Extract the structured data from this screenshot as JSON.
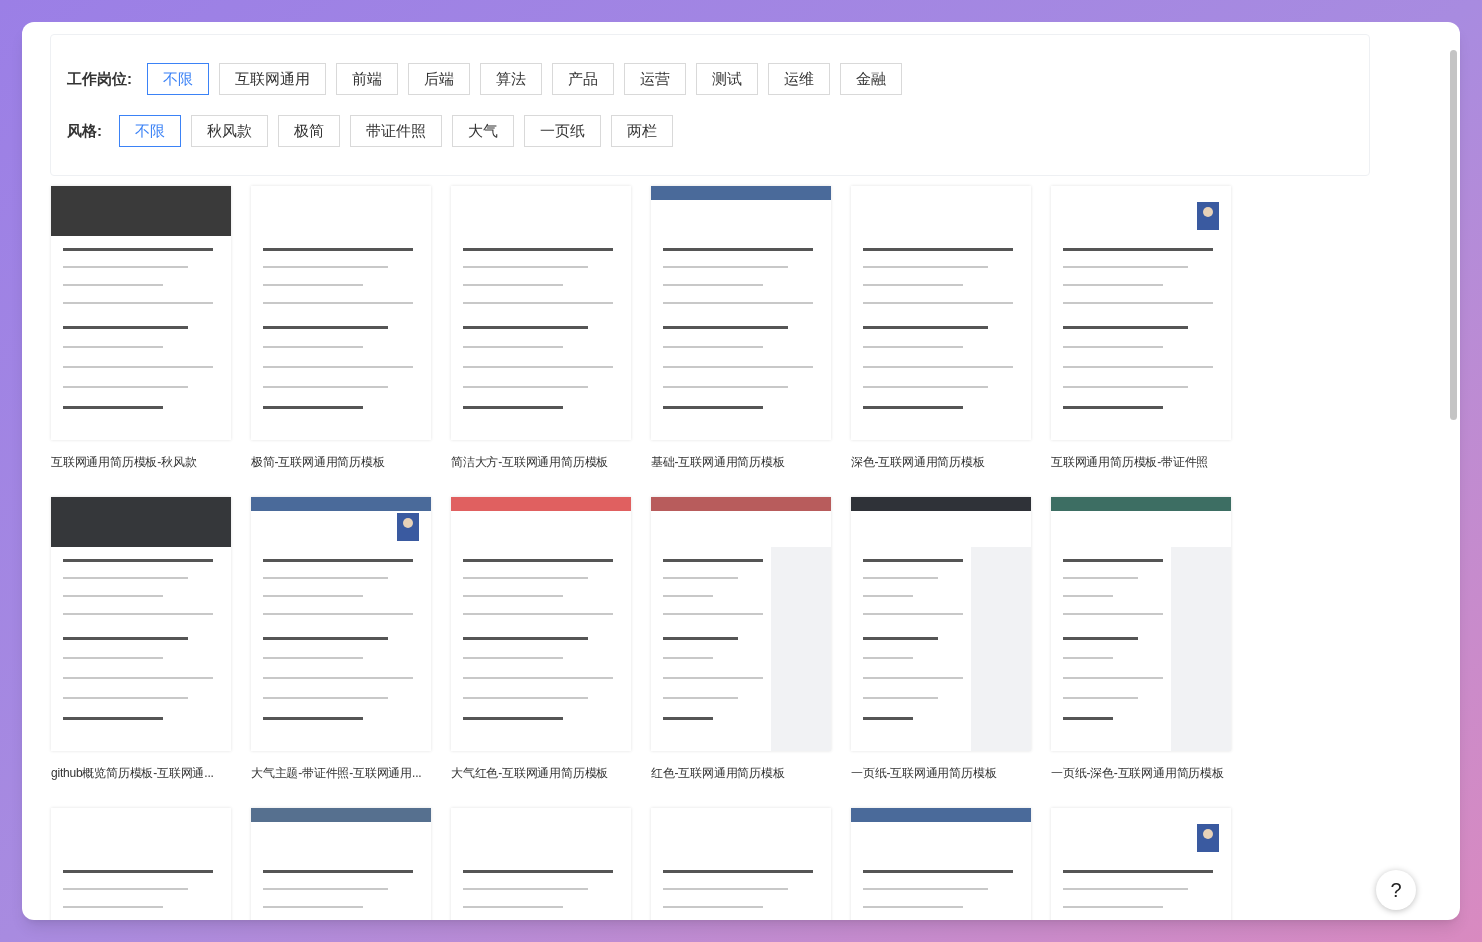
{
  "filters": [
    {
      "label": "工作岗位:",
      "options": [
        {
          "label": "不限",
          "selected": true
        },
        {
          "label": "互联网通用",
          "selected": false
        },
        {
          "label": "前端",
          "selected": false
        },
        {
          "label": "后端",
          "selected": false
        },
        {
          "label": "算法",
          "selected": false
        },
        {
          "label": "产品",
          "selected": false
        },
        {
          "label": "运营",
          "selected": false
        },
        {
          "label": "测试",
          "selected": false
        },
        {
          "label": "运维",
          "selected": false
        },
        {
          "label": "金融",
          "selected": false
        }
      ]
    },
    {
      "label": "风格:",
      "options": [
        {
          "label": "不限",
          "selected": true
        },
        {
          "label": "秋风款",
          "selected": false
        },
        {
          "label": "极简",
          "selected": false
        },
        {
          "label": "带证件照",
          "selected": false
        },
        {
          "label": "大气",
          "selected": false
        },
        {
          "label": "一页纸",
          "selected": false
        },
        {
          "label": "两栏",
          "selected": false
        }
      ]
    }
  ],
  "templates": [
    {
      "kind": "picture",
      "title": "互联网通用简历模板-秋风款"
    },
    {
      "kind": "picture",
      "title": "极简-互联网通用简历模板"
    },
    {
      "kind": "picture",
      "title": "简洁大方-互联网通用简历模板"
    },
    {
      "kind": "picture",
      "title": "基础-互联网通用简历模板"
    },
    {
      "kind": "picture",
      "title": "深色-互联网通用简历模板"
    },
    {
      "kind": "picture",
      "title": "互联网通用简历模板-带证件照"
    },
    {
      "kind": "picture",
      "title": "github概览简历模板-互联网通..."
    },
    {
      "kind": "picture",
      "title": "大气主题-带证件照-互联网通用..."
    },
    {
      "kind": "picture",
      "title": "大气红色-互联网通用简历模板"
    },
    {
      "kind": "picture",
      "title": "红色-互联网通用简历模板"
    },
    {
      "kind": "picture",
      "title": "一页纸-互联网通用简历模板"
    },
    {
      "kind": "picture",
      "title": "一页纸-深色-互联网通用简历模板"
    },
    {
      "kind": "picture"
    },
    {
      "kind": "picture"
    },
    {
      "kind": "picture"
    },
    {
      "kind": "picture"
    },
    {
      "kind": "picture"
    },
    {
      "kind": "picture"
    }
  ],
  "help_button": "?"
}
